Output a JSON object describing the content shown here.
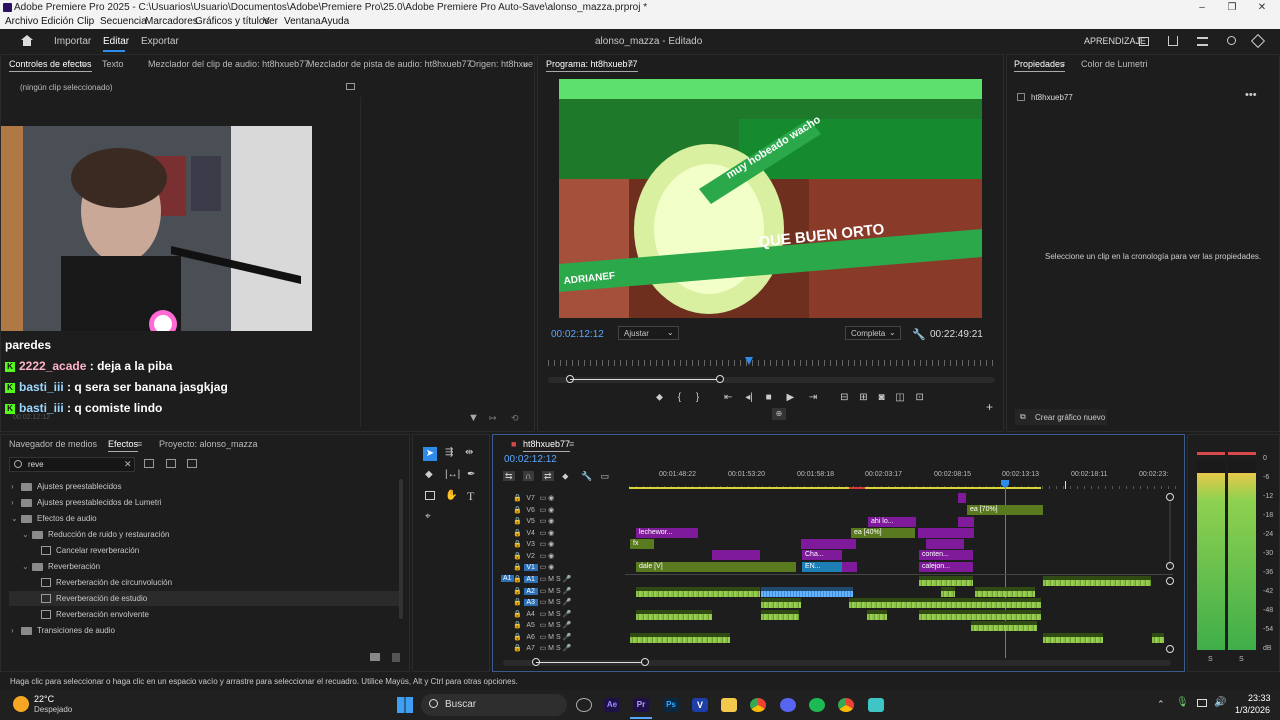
{
  "window": {
    "title": "Adobe Premiere Pro 2025 - C:\\Usuarios\\Usuario\\Documentos\\Adobe\\Premiere Pro\\25.0\\Adobe Premiere Pro Auto-Save\\alonso_mazza.prproj *"
  },
  "menu": [
    "Archivo",
    "Edición",
    "Clip",
    "Secuencia",
    "Marcadores",
    "Gráficos y títulos",
    "Ver",
    "Ventana",
    "Ayuda"
  ],
  "workspace": {
    "importar": "Importar",
    "editar": "Editar",
    "exportar": "Exportar",
    "project_title": "alonso_mazza - Editado",
    "aprendizaje": "APRENDIZAJE"
  },
  "top_left_tabs": [
    "Controles de efectos",
    "Texto",
    "Mezclador del clip de audio: ht8hxueb77",
    "Mezclador de pista de audio: ht8hxueb77",
    "Origen: ht8hxue"
  ],
  "effect_controls": {
    "no_clip": "(ningún clip seleccionado)",
    "timecode": "00:02:12:12"
  },
  "chat": {
    "partial": "paredes",
    "lines": [
      {
        "user": "2222_acade",
        "msg": ": deja a la piba",
        "color": "#ffb3c7"
      },
      {
        "user": "basti_iii",
        "msg": ": q sera ser banana jasgkjag",
        "color": "#9bd7ff"
      },
      {
        "user": "basti_iii",
        "msg": ": q comiste lindo",
        "color": "#9bd7ff"
      }
    ]
  },
  "program": {
    "tab": "Programa: ht8hxueb77",
    "timecode": "00:02:12:12",
    "fit": "Ajustar",
    "quality": "Completa",
    "duration": "00:22:49:21",
    "frame_text_1": "muy hobeado wacho",
    "frame_text_2": "QUE BUEN ORTO",
    "frame_text_3": "ADRIANEF"
  },
  "properties": {
    "tab": "Propiedades",
    "tab2": "Color de Lumetri",
    "seq_name": "ht8hxueb77",
    "empty_msg": "Seleccione un clip en la cronología para ver las propiedades.",
    "create_graphic": "Crear gráfico nuevo"
  },
  "effects_panel": {
    "tabs": [
      "Navegador de medios",
      "Efectos",
      "Proyecto: alonso_mazza"
    ],
    "search": "reve",
    "tree": [
      {
        "label": "Ajustes preestablecidos",
        "level": 0,
        "type": "folder",
        "arrow": "›"
      },
      {
        "label": "Ajustes preestablecidos de Lumetri",
        "level": 0,
        "type": "folder",
        "arrow": "›"
      },
      {
        "label": "Efectos de audio",
        "level": 0,
        "type": "folder",
        "arrow": "⌄"
      },
      {
        "label": "Reducción de ruido y restauración",
        "level": 1,
        "type": "folder",
        "arrow": "⌄"
      },
      {
        "label": "Cancelar reverberación",
        "level": 2,
        "type": "fx",
        "arrow": ""
      },
      {
        "label": "Reverberación",
        "level": 1,
        "type": "folder",
        "arrow": "⌄"
      },
      {
        "label": "Reverberación de circunvolución",
        "level": 2,
        "type": "fx",
        "arrow": ""
      },
      {
        "label": "Reverberación de estudio",
        "level": 2,
        "type": "fx",
        "arrow": "",
        "selected": true
      },
      {
        "label": "Reverberación envolvente",
        "level": 2,
        "type": "fx",
        "arrow": ""
      },
      {
        "label": "Transiciones de audio",
        "level": 0,
        "type": "folder",
        "arrow": "›"
      }
    ]
  },
  "timeline": {
    "tab": "ht8hxueb77",
    "timecode": "00:02:12:12",
    "ruler": [
      "00:01:48:22",
      "00:01:53:20",
      "00:01:58:18",
      "00:02:03:17",
      "00:02:08:15",
      "00:02:13:13",
      "00:02:18:11",
      "00:02:23:"
    ],
    "video_tracks": [
      "V7",
      "V6",
      "V5",
      "V4",
      "V3",
      "V2",
      "V1"
    ],
    "audio_tracks": [
      "A1",
      "A2",
      "A3",
      "A4",
      "A5",
      "A6",
      "A7"
    ],
    "clips": {
      "c1": "lechewor...",
      "c2": "fx",
      "c3": "ea [40%]",
      "c4": "ahi lo...",
      "c5": "ea [70%]",
      "c6": "conten...",
      "c7": "Cha...",
      "c8": "EN...",
      "c9": "dale [V]",
      "c10": "calejon..."
    }
  },
  "meter": {
    "scale": [
      "0",
      "-6",
      "-12",
      "-18",
      "-24",
      "-30",
      "-36",
      "-42",
      "-48",
      "-54",
      "dB"
    ],
    "s": "S"
  },
  "status": "Haga clic para seleccionar o haga clic en un espacio vacío y arrastre para seleccionar el recuadro. Utilice Mayús, Alt y Ctrl para otras opciones.",
  "taskbar": {
    "temp": "22°C",
    "weather": "Despejado",
    "search": "Buscar",
    "time": "23:33",
    "date": "1/3/2026"
  },
  "colors": {
    "accent": "#2d8ceb",
    "video_green": "#5a7a1f",
    "video_purple": "#7f1b9b",
    "audio_green": "#8bc34a",
    "audio_blue": "#66b2ff",
    "kick_green": "#53fc18"
  }
}
